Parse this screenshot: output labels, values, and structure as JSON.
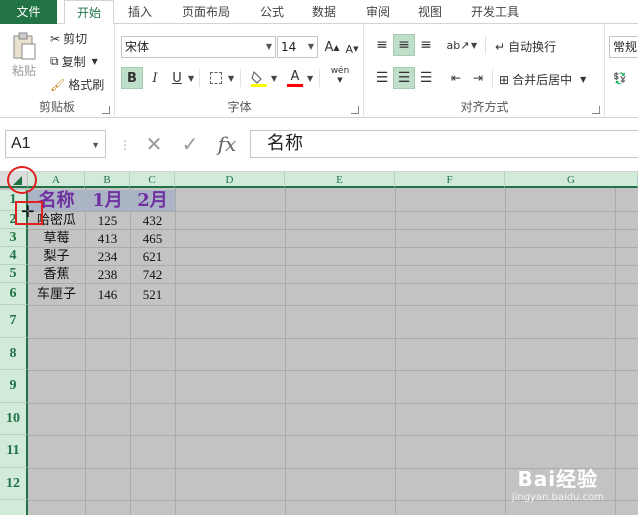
{
  "tabs": [
    "文件",
    "开始",
    "插入",
    "页面布局",
    "公式",
    "数据",
    "审阅",
    "视图",
    "开发工具"
  ],
  "ribbon": {
    "clipboard": {
      "paste": "粘贴",
      "cut": "剪切",
      "copy": "复制",
      "format_painter": "格式刷",
      "label": "剪贴板"
    },
    "font": {
      "name": "宋体",
      "size": "14",
      "bold": "B",
      "italic": "I",
      "underline": "U",
      "grow": "A",
      "shrink": "A",
      "font_color": "A",
      "phonetic": "wén",
      "label": "字体"
    },
    "alignment": {
      "wrap": "自动换行",
      "merge": "合并后居中",
      "label": "对齐方式"
    },
    "number": {
      "format": "常规"
    }
  },
  "formula_bar": {
    "name_box": "A1",
    "formula": "名称",
    "fx": "fx"
  },
  "columns": [
    "A",
    "B",
    "C",
    "D",
    "E",
    "F",
    "G"
  ],
  "rows": [
    "1",
    "2",
    "3",
    "4",
    "5",
    "6",
    "7",
    "8",
    "9",
    "10",
    "11",
    "12"
  ],
  "table": {
    "header": [
      "名称",
      "1月",
      "2月"
    ],
    "rows": [
      [
        "哈密瓜",
        "125",
        "432"
      ],
      [
        "草莓",
        "413",
        "465"
      ],
      [
        "梨子",
        "234",
        "621"
      ],
      [
        "香蕉",
        "238",
        "742"
      ],
      [
        "车厘子",
        "146",
        "521"
      ]
    ]
  },
  "watermark": {
    "brand": "Bai经验",
    "url": "jingyan.baidu.com"
  },
  "colors": {
    "accent": "#217346",
    "header_text": "#7030a0",
    "selection": "#c3c3c3"
  }
}
